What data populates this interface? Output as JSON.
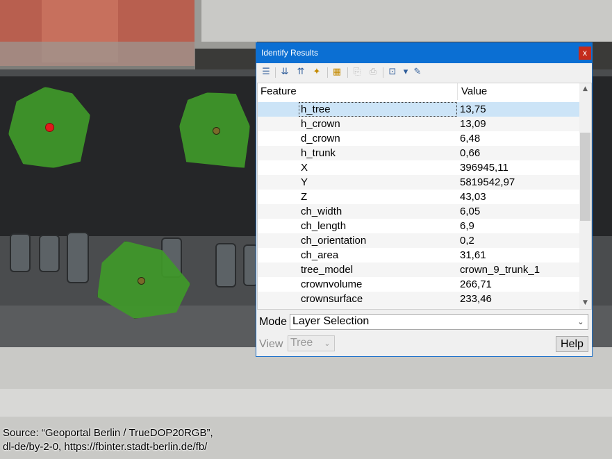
{
  "dialog": {
    "title": "Identify Results",
    "close_glyph": "x",
    "toolbar": [
      {
        "icon": "expand-tree-icon",
        "glyph": "☰",
        "enabled": true
      },
      {
        "icon": "expand-all-icon",
        "glyph": "⇊",
        "enabled": true
      },
      {
        "icon": "collapse-all-icon",
        "glyph": "⇈",
        "enabled": true
      },
      {
        "icon": "expand-new-results-icon",
        "glyph": "✦",
        "enabled": true
      },
      {
        "icon": "clear-results-icon",
        "glyph": "▦",
        "enabled": true
      },
      {
        "icon": "copy-feature-icon",
        "glyph": "⎘",
        "enabled": false
      },
      {
        "icon": "print-response-icon",
        "glyph": "⎙",
        "enabled": false
      },
      {
        "icon": "identify-select-icon",
        "glyph": "⊡",
        "enabled": true
      },
      {
        "icon": "dropdown-arrow-icon",
        "glyph": "▾",
        "enabled": true
      },
      {
        "icon": "identify-settings-icon",
        "glyph": "✎",
        "enabled": true
      }
    ]
  },
  "table": {
    "header_feature": "Feature",
    "header_value": "Value",
    "rows": [
      {
        "field": "h_tree",
        "value": "13,75"
      },
      {
        "field": "h_crown",
        "value": "13,09"
      },
      {
        "field": "d_crown",
        "value": "6,48"
      },
      {
        "field": "h_trunk",
        "value": "0,66"
      },
      {
        "field": "X",
        "value": "396945,11"
      },
      {
        "field": "Y",
        "value": "5819542,97"
      },
      {
        "field": "Z",
        "value": "43,03"
      },
      {
        "field": "ch_width",
        "value": "6,05"
      },
      {
        "field": "ch_length",
        "value": "6,9"
      },
      {
        "field": "ch_orientation",
        "value": "0,2"
      },
      {
        "field": "ch_area",
        "value": "31,61"
      },
      {
        "field": "tree_model",
        "value": "crown_9_trunk_1"
      },
      {
        "field": "crownvolume",
        "value": "266,71"
      },
      {
        "field": "crownsurface",
        "value": "233,46"
      }
    ]
  },
  "mode": {
    "label": "Mode",
    "value": "Layer Selection"
  },
  "view": {
    "label": "View",
    "value": "Tree"
  },
  "help_label": "Help",
  "attribution": {
    "line1": "Source: “Geoportal Berlin / TrueDOP20RGB”,",
    "line2": "dl-de/by-2-0, https://fbinter.stadt-berlin.de/fb/"
  },
  "colors": {
    "title_bar": "#0b6fd3",
    "selected_row": "#cce4f7",
    "tree_crown": "#3f9a2a",
    "selected_point": "#e31a1c",
    "tree_point": "#7a6a2a"
  }
}
